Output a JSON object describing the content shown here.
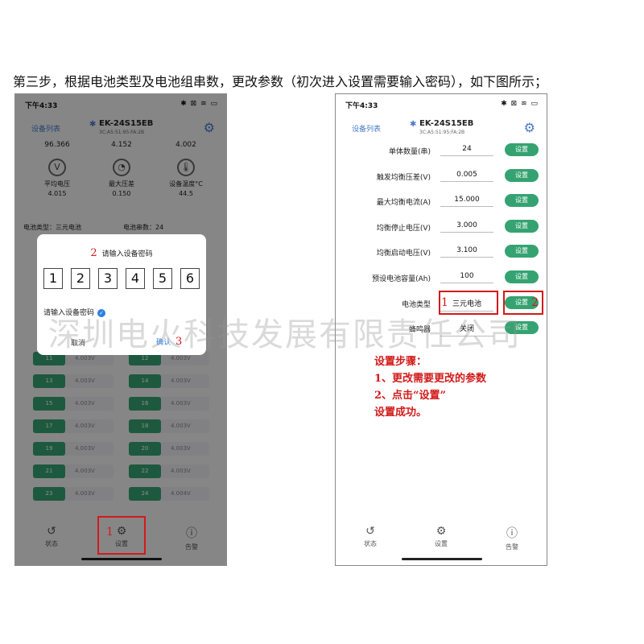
{
  "intro": "第三步，根据电池类型及电池组串数，更改参数（初次进入设置需要输入密码），如下图所示；",
  "status": {
    "time": "下午4:33",
    "icons": "✱ ⊠ ≋ ▭"
  },
  "device": {
    "list_label": "设备列表",
    "name": "EK-24S15EB",
    "mac": "3C:A5:51:95:FA:2B"
  },
  "left": {
    "stats": [
      "96.366",
      "4.152",
      "4.002"
    ],
    "metrics": [
      {
        "label": "平均电压",
        "value": "4.015",
        "icon": "V"
      },
      {
        "label": "最大压差",
        "value": "0.150",
        "icon": "◔"
      },
      {
        "label": "设备温度°C",
        "value": "44.5",
        "icon": "🌡"
      }
    ],
    "battery_type_label": "电池类型：三元电池",
    "battery_count_label": "电池串数：24",
    "cells": [
      {
        "num": "11",
        "volt": "4.003V"
      },
      {
        "num": "12",
        "volt": "4.003V"
      },
      {
        "num": "13",
        "volt": "4.003V"
      },
      {
        "num": "14",
        "volt": "4.003V"
      },
      {
        "num": "15",
        "volt": "4.003V"
      },
      {
        "num": "16",
        "volt": "4.003V"
      },
      {
        "num": "17",
        "volt": "4.003V"
      },
      {
        "num": "18",
        "volt": "4.003V"
      },
      {
        "num": "19",
        "volt": "4.003V"
      },
      {
        "num": "20",
        "volt": "4.003V"
      },
      {
        "num": "21",
        "volt": "4.003V"
      },
      {
        "num": "22",
        "volt": "4.003V"
      },
      {
        "num": "23",
        "volt": "4.003V"
      },
      {
        "num": "24",
        "volt": "4.004V"
      }
    ],
    "dialog": {
      "mark": "2",
      "title": "请输入设备密码",
      "pins": [
        "1",
        "2",
        "3",
        "4",
        "5",
        "6"
      ],
      "hint": "请输入设备密码",
      "cancel": "取消",
      "ok": "确认",
      "ok_mark": "3"
    },
    "settings_mark": "1"
  },
  "right": {
    "rows": [
      {
        "label": "单体数量(串)",
        "value": "24",
        "button": "设置"
      },
      {
        "label": "触发均衡压差(V)",
        "value": "0.005",
        "button": "设置"
      },
      {
        "label": "最大均衡电流(A)",
        "value": "15.000",
        "button": "设置"
      },
      {
        "label": "均衡停止电压(V)",
        "value": "3.000",
        "button": "设置"
      },
      {
        "label": "均衡启动电压(V)",
        "value": "3.100",
        "button": "设置"
      },
      {
        "label": "预设电池容量(Ah)",
        "value": "100",
        "button": "设置"
      },
      {
        "label": "电池类型",
        "value": "三元电池",
        "button": "设置"
      },
      {
        "label": "蜂鸣器",
        "value": "关闭",
        "button": "设置"
      }
    ],
    "mark1": "1",
    "mark2": "2",
    "steps": [
      "设置步骤：",
      "1、更改需要更改的参数",
      "2、点击“设置”",
      "设置成功。"
    ]
  },
  "tabs": [
    {
      "label": "状态",
      "icon": "↺"
    },
    {
      "label": "设置",
      "icon": "⚙"
    },
    {
      "label": "告警",
      "icon": "ⓘ"
    }
  ],
  "watermark": "深圳电火科技发展有限责任公司",
  "colors": {
    "green": "#35a371",
    "red_annotation": "#d21a1a",
    "blue": "#4a7bc8"
  }
}
